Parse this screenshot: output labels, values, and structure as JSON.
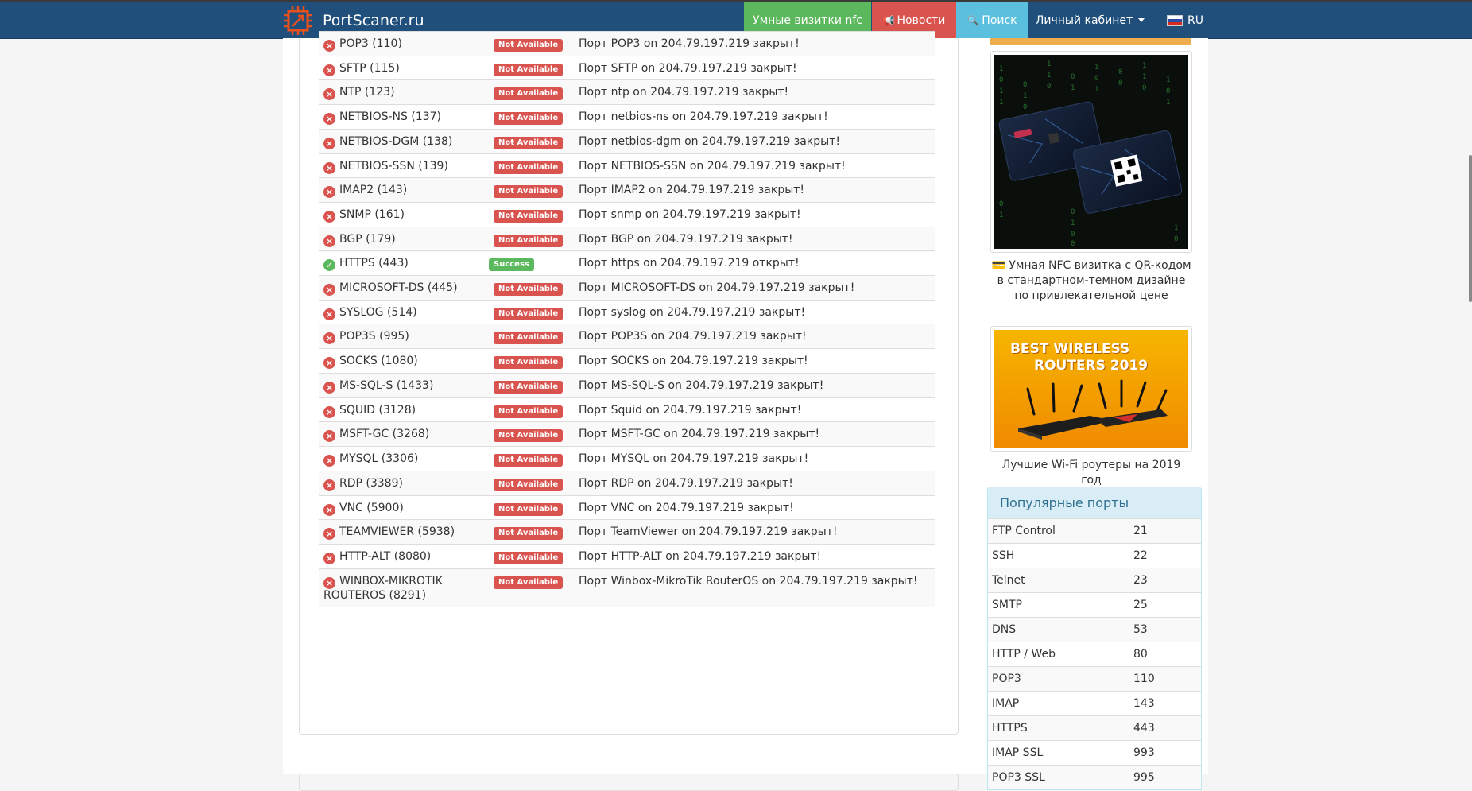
{
  "brand": {
    "name": "PortScaner.ru"
  },
  "nav": {
    "nfc": "Умные визитки nfc",
    "news": "Новости",
    "search": "Поиск",
    "cabinet": "Личный кабинет",
    "lang": "RU"
  },
  "ports": [
    {
      "name": "POP3 (110)",
      "status": "err",
      "badge": "Not Available",
      "msg": "Порт POP3 on 204.79.197.219 закрыт!"
    },
    {
      "name": "SFTP (115)",
      "status": "err",
      "badge": "Not Available",
      "msg": "Порт SFTP on 204.79.197.219 закрыт!"
    },
    {
      "name": "NTP (123)",
      "status": "err",
      "badge": "Not Available",
      "msg": "Порт ntp on 204.79.197.219 закрыт!"
    },
    {
      "name": "NETBIOS-NS (137)",
      "status": "err",
      "badge": "Not Available",
      "msg": "Порт netbios-ns on 204.79.197.219 закрыт!"
    },
    {
      "name": "NETBIOS-DGM (138)",
      "status": "err",
      "badge": "Not Available",
      "msg": "Порт netbios-dgm on 204.79.197.219 закрыт!"
    },
    {
      "name": "NETBIOS-SSN (139)",
      "status": "err",
      "badge": "Not Available",
      "msg": "Порт NETBIOS-SSN on 204.79.197.219 закрыт!"
    },
    {
      "name": "IMAP2 (143)",
      "status": "err",
      "badge": "Not Available",
      "msg": "Порт IMAP2 on 204.79.197.219 закрыт!"
    },
    {
      "name": "SNMP (161)",
      "status": "err",
      "badge": "Not Available",
      "msg": "Порт snmp on 204.79.197.219 закрыт!"
    },
    {
      "name": "BGP (179)",
      "status": "err",
      "badge": "Not Available",
      "msg": "Порт BGP on 204.79.197.219 закрыт!"
    },
    {
      "name": "HTTPS (443)",
      "status": "ok",
      "badge": "Success",
      "msg": "Порт https on 204.79.197.219 открыт!"
    },
    {
      "name": "MICROSOFT-DS (445)",
      "status": "err",
      "badge": "Not Available",
      "msg": "Порт MICROSOFT-DS on 204.79.197.219 закрыт!"
    },
    {
      "name": "SYSLOG (514)",
      "status": "err",
      "badge": "Not Available",
      "msg": "Порт syslog on 204.79.197.219 закрыт!"
    },
    {
      "name": "POP3S (995)",
      "status": "err",
      "badge": "Not Available",
      "msg": "Порт POP3S on 204.79.197.219 закрыт!"
    },
    {
      "name": "SOCKS (1080)",
      "status": "err",
      "badge": "Not Available",
      "msg": "Порт SOCKS on 204.79.197.219 закрыт!"
    },
    {
      "name": "MS-SQL-S (1433)",
      "status": "err",
      "badge": "Not Available",
      "msg": "Порт MS-SQL-S on 204.79.197.219 закрыт!"
    },
    {
      "name": "SQUID (3128)",
      "status": "err",
      "badge": "Not Available",
      "msg": "Порт Squid on 204.79.197.219 закрыт!"
    },
    {
      "name": "MSFT-GC (3268)",
      "status": "err",
      "badge": "Not Available",
      "msg": "Порт MSFT-GC on 204.79.197.219 закрыт!"
    },
    {
      "name": "MYSQL (3306)",
      "status": "err",
      "badge": "Not Available",
      "msg": "Порт MYSQL on 204.79.197.219 закрыт!"
    },
    {
      "name": "RDP (3389)",
      "status": "err",
      "badge": "Not Available",
      "msg": "Порт RDP on 204.79.197.219 закрыт!"
    },
    {
      "name": "VNC (5900)",
      "status": "err",
      "badge": "Not Available",
      "msg": "Порт VNC on 204.79.197.219 закрыт!"
    },
    {
      "name": "TEAMVIEWER (5938)",
      "status": "err",
      "badge": "Not Available",
      "msg": "Порт TeamViewer on 204.79.197.219 закрыт!"
    },
    {
      "name": "HTTP-ALT (8080)",
      "status": "err",
      "badge": "Not Available",
      "msg": "Порт HTTP-ALT on 204.79.197.219 закрыт!"
    },
    {
      "name": "WINBOX-MIKROTIK ROUTEROS (8291)",
      "status": "err",
      "badge": "Not Available",
      "msg": "Порт Winbox-MikroTik RouterOS on 204.79.197.219 закрыт!"
    }
  ],
  "sidebar": {
    "ad1_caption": "💳 Умная NFC визитка с QR-кодом в стандартном-темном дизайне по привлекательной цене",
    "ad2_title_line1": "BEST WIRELESS",
    "ad2_title_line2": "ROUTERS 2019",
    "ad2_caption": "Лучшие Wi-Fi роутеры на 2019 год",
    "popular_title": "Популярные порты",
    "popular": [
      {
        "name": "FTP Control",
        "port": "21"
      },
      {
        "name": "SSH",
        "port": "22"
      },
      {
        "name": "Telnet",
        "port": "23"
      },
      {
        "name": "SMTP",
        "port": "25"
      },
      {
        "name": "DNS",
        "port": "53"
      },
      {
        "name": "HTTP / Web",
        "port": "80"
      },
      {
        "name": "POP3",
        "port": "110"
      },
      {
        "name": "IMAP",
        "port": "143"
      },
      {
        "name": "HTTPS",
        "port": "443"
      },
      {
        "name": "IMAP SSL",
        "port": "993"
      },
      {
        "name": "POP3 SSL",
        "port": "995"
      }
    ]
  },
  "colors": {
    "navbar": "#1f4f7a",
    "success": "#5cb85c",
    "danger": "#d9534f",
    "info": "#5bc0de"
  }
}
